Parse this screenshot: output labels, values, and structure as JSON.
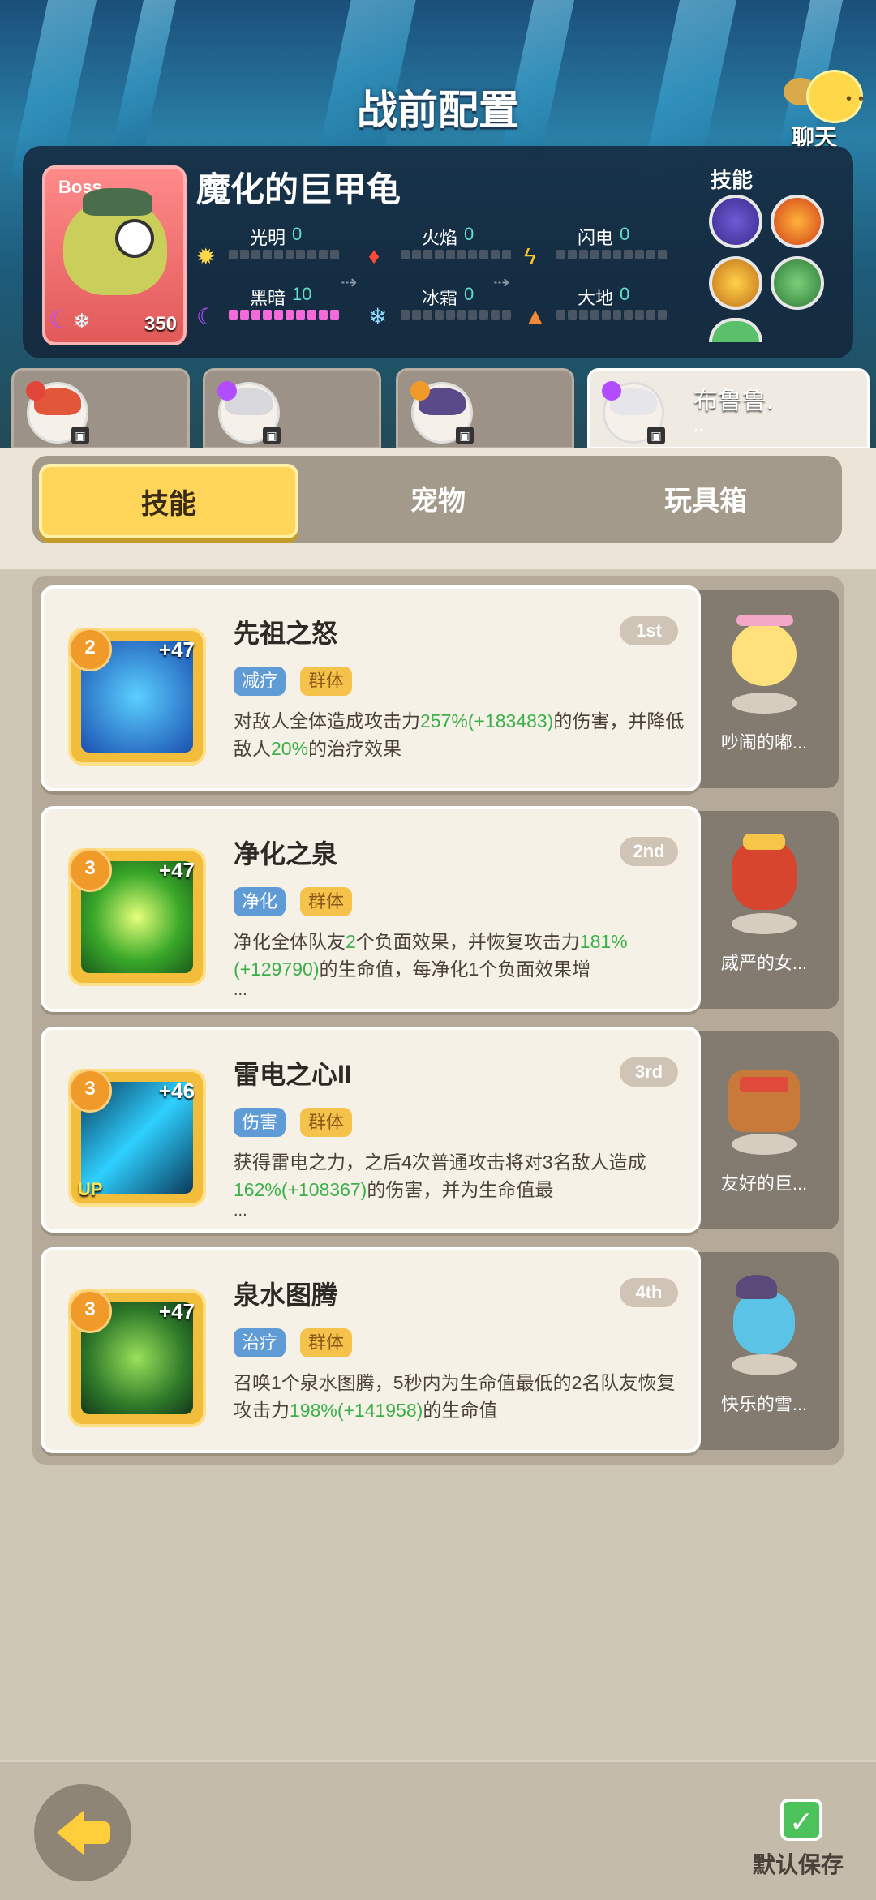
{
  "header": {
    "title": "战前配置",
    "chat_label": "聊天"
  },
  "boss": {
    "tag": "Boss",
    "name": "魔化的巨甲龟",
    "level": "350",
    "attributes": [
      {
        "name": "光明",
        "value": "0"
      },
      {
        "name": "火焰",
        "value": "0"
      },
      {
        "name": "闪电",
        "value": "0"
      },
      {
        "name": "黑暗",
        "value": "10"
      },
      {
        "name": "冰霜",
        "value": "0"
      },
      {
        "name": "大地",
        "value": "0"
      }
    ],
    "skills_title": "技能"
  },
  "team": [
    {
      "name": ""
    },
    {
      "name": ""
    },
    {
      "name": ""
    },
    {
      "name": "布鲁鲁.",
      "name2": ".."
    }
  ],
  "tabs": [
    "技能",
    "宠物",
    "玩具箱"
  ],
  "cards": [
    {
      "name": "先祖之怒",
      "rank": "1st",
      "star": "2",
      "plus": "+47",
      "tags": [
        "减疗",
        "群体"
      ],
      "desc_parts": [
        "对敌人全体造成攻击力",
        "257%",
        "(+183483)",
        "的伤害",
        "，并降低敌人",
        "20%",
        "的治疗效果"
      ],
      "pet": "吵闹的嘟..."
    },
    {
      "name": "净化之泉",
      "rank": "2nd",
      "star": "3",
      "plus": "+47",
      "tags": [
        "净化",
        "群体"
      ],
      "desc_parts": [
        "净化全体队友",
        "2",
        "个负面效果，并恢复攻击力",
        "181%",
        "(+129790)",
        "的生命值，每净化1个负面效果增"
      ],
      "more": "...",
      "pet": "威严的女..."
    },
    {
      "name": "雷电之心II",
      "rank": "3rd",
      "star": "3",
      "plus": "+46",
      "up": "UP",
      "tags": [
        "伤害",
        "群体"
      ],
      "desc_parts": [
        "获得雷电之力，之后4次普通攻击将对3名敌人造成",
        "162%",
        "(+108367)",
        "的伤害，并为生命值最"
      ],
      "more": "...",
      "pet": "友好的巨..."
    },
    {
      "name": "泉水图腾",
      "rank": "4th",
      "star": "3",
      "plus": "+47",
      "tags": [
        "治疗",
        "群体"
      ],
      "desc_parts": [
        "召唤1个泉水图腾，5秒内为生命值最低的2名队友恢复攻击力",
        "198%",
        "(+141958)",
        "的生命值"
      ],
      "pet": "快乐的雪..."
    }
  ],
  "footer": {
    "save_label": "默认保存",
    "save_check": "✓"
  },
  "colors": {
    "accent": "#ffd65a",
    "highlight": "#3bb04a",
    "tag_blue": "#5f9bd5",
    "tag_gold": "#f5c24b"
  }
}
